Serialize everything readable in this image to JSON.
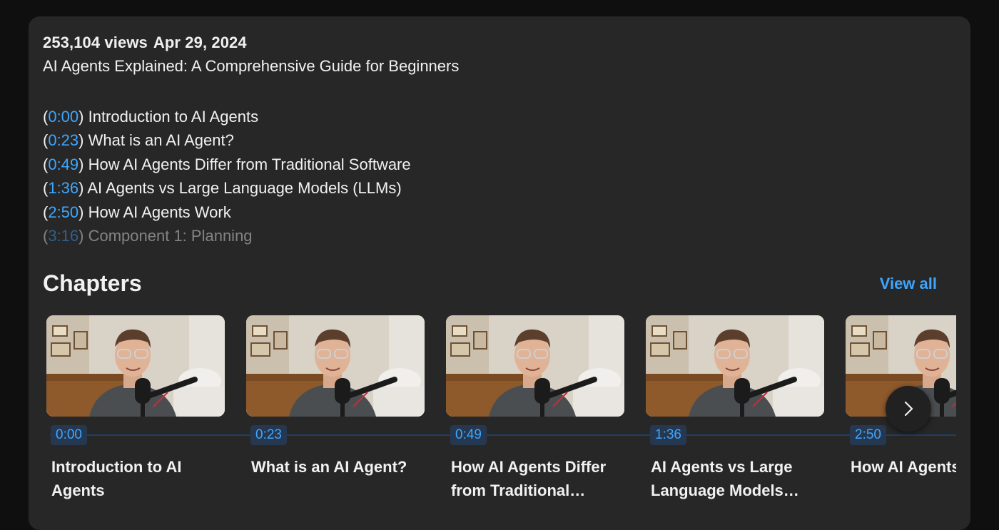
{
  "video": {
    "views": "253,104 views",
    "date": "Apr 29, 2024",
    "title": "AI Agents Explained: A Comprehensive Guide for Beginners"
  },
  "description_chapters": [
    {
      "open": "(",
      "time": "0:00",
      "close": ")",
      "label": " Introduction to AI Agents"
    },
    {
      "open": "(",
      "time": "0:23",
      "close": ")",
      "label": " What is an AI Agent?"
    },
    {
      "open": "(",
      "time": "0:49",
      "close": ")",
      "label": " How AI Agents Differ from Traditional Software"
    },
    {
      "open": "(",
      "time": "1:36",
      "close": ")",
      "label": " AI Agents vs Large Language Models (LLMs)"
    },
    {
      "open": "(",
      "time": "2:50",
      "close": ")",
      "label": " How AI Agents Work"
    },
    {
      "open": "(",
      "time": "3:16",
      "close": ")",
      "label": " Component 1: Planning"
    }
  ],
  "chapters_section": {
    "heading": "Chapters",
    "view_all": "View all",
    "cards": [
      {
        "time": "0:00",
        "title": "Introduction to AI Agents"
      },
      {
        "time": "0:23",
        "title": "What is an AI Agent?"
      },
      {
        "time": "0:49",
        "title": "How AI Agents Differ from Traditional…"
      },
      {
        "time": "1:36",
        "title": "AI Agents vs Large Language Models…"
      },
      {
        "time": "2:50",
        "title": "How AI Agents Work"
      }
    ],
    "next_icon": "chevron-right-icon"
  },
  "colors": {
    "accent": "#3ea6ff",
    "panel": "#272727",
    "background": "#0f0f0f"
  }
}
